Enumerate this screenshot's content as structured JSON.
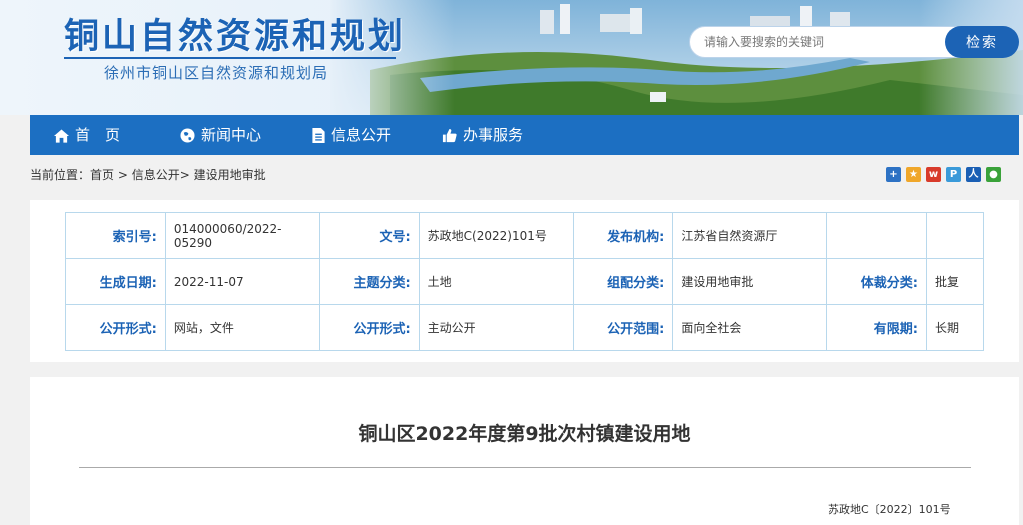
{
  "header": {
    "title": "铜山自然资源和规划",
    "subtitle": "徐州市铜山区自然资源和规划局"
  },
  "search": {
    "placeholder": "请输入要搜索的关键词",
    "button_label": "检索"
  },
  "nav": {
    "items": [
      {
        "label": "首　页",
        "icon": "home-icon"
      },
      {
        "label": "新闻中心",
        "icon": "globe-icon"
      },
      {
        "label": "信息公开",
        "icon": "document-icon"
      },
      {
        "label": "办事服务",
        "icon": "thumbs-up-icon"
      }
    ]
  },
  "breadcrumb": {
    "prefix": "当前位置：",
    "items": [
      "首页",
      "信息公开",
      "建设用地审批"
    ],
    "sep1": " > ",
    "sep2": "> "
  },
  "share": {
    "icons": [
      {
        "name": "plus-share-icon",
        "color": "#2d72c4"
      },
      {
        "name": "qzone-share-icon",
        "color": "#f0a72a"
      },
      {
        "name": "weibo-share-icon",
        "color": "#d83b2b"
      },
      {
        "name": "tencent-share-icon",
        "color": "#3a9ad9"
      },
      {
        "name": "renren-share-icon",
        "color": "#1a5fb4"
      },
      {
        "name": "wechat-share-icon",
        "color": "#3aa23a"
      }
    ]
  },
  "meta": {
    "rows": [
      [
        {
          "k": "索引号:",
          "v": "014000060/2022-05290"
        },
        {
          "k": "文号:",
          "v": "苏政地C(2022)101号"
        },
        {
          "k": "发布机构:",
          "v": "江苏省自然资源厅"
        },
        {
          "k": "",
          "v": ""
        }
      ],
      [
        {
          "k": "生成日期:",
          "v": "2022-11-07"
        },
        {
          "k": "主题分类:",
          "v": "土地"
        },
        {
          "k": "组配分类:",
          "v": "建设用地审批"
        },
        {
          "k": "体裁分类:",
          "v": "批复"
        }
      ],
      [
        {
          "k": "公开形式:",
          "v": "网站，文件"
        },
        {
          "k": "公开形式:",
          "v": "主动公开"
        },
        {
          "k": "公开范围:",
          "v": "面向全社会"
        },
        {
          "k": "有限期:",
          "v": "长期"
        }
      ]
    ]
  },
  "article": {
    "title": "铜山区2022年度第9批次村镇建设用地",
    "doc_number": "苏政地C〔2022〕101号"
  }
}
